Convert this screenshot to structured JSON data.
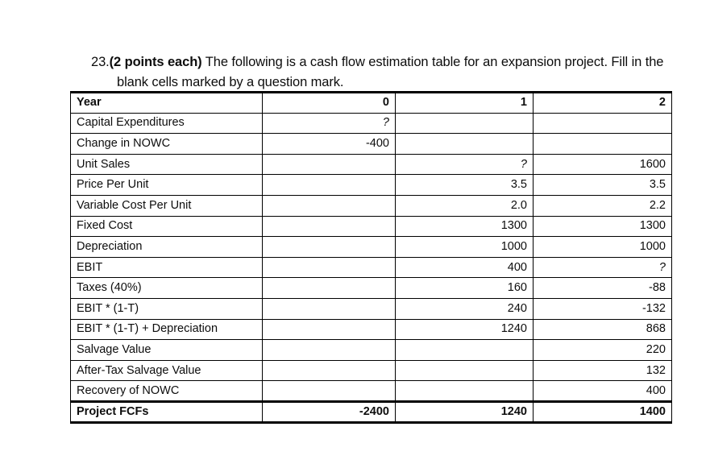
{
  "prompt": {
    "number": "23.",
    "bold_part": "(2 points each)",
    "body": " The following is a cash flow estimation table for an expansion project. Fill in the blank cells marked by a question mark."
  },
  "table": {
    "columns": [
      "Year",
      "0",
      "1",
      "2"
    ],
    "rows": [
      {
        "label": "Capital Expenditures",
        "values": [
          "?",
          "",
          ""
        ]
      },
      {
        "label": "Change in NOWC",
        "values": [
          "-400",
          "",
          ""
        ]
      },
      {
        "label": "Unit Sales",
        "values": [
          "",
          "?",
          "1600"
        ]
      },
      {
        "label": "Price Per Unit",
        "values": [
          "",
          "3.5",
          "3.5"
        ]
      },
      {
        "label": "Variable Cost Per Unit",
        "values": [
          "",
          "2.0",
          "2.2"
        ]
      },
      {
        "label": "Fixed Cost",
        "values": [
          "",
          "1300",
          "1300"
        ]
      },
      {
        "label": "Depreciation",
        "values": [
          "",
          "1000",
          "1000"
        ]
      },
      {
        "label": "EBIT",
        "values": [
          "",
          "400",
          "?"
        ]
      },
      {
        "label": "Taxes (40%)",
        "values": [
          "",
          "160",
          "-88"
        ]
      },
      {
        "label": "EBIT * (1-T)",
        "values": [
          "",
          "240",
          "-132"
        ]
      },
      {
        "label": "EBIT * (1-T) + Depreciation",
        "values": [
          "",
          "1240",
          "868"
        ]
      },
      {
        "label": "Salvage Value",
        "values": [
          "",
          "",
          "220"
        ]
      },
      {
        "label": "After-Tax Salvage Value",
        "values": [
          "",
          "",
          "132"
        ]
      },
      {
        "label": "Recovery of NOWC",
        "values": [
          "",
          "",
          "400"
        ]
      }
    ],
    "total_row": {
      "label": "Project FCFs",
      "values": [
        "-2400",
        "1240",
        "1400"
      ]
    }
  },
  "colors": {
    "text": "#0d0d0d",
    "border": "#000000",
    "background": "#ffffff"
  }
}
